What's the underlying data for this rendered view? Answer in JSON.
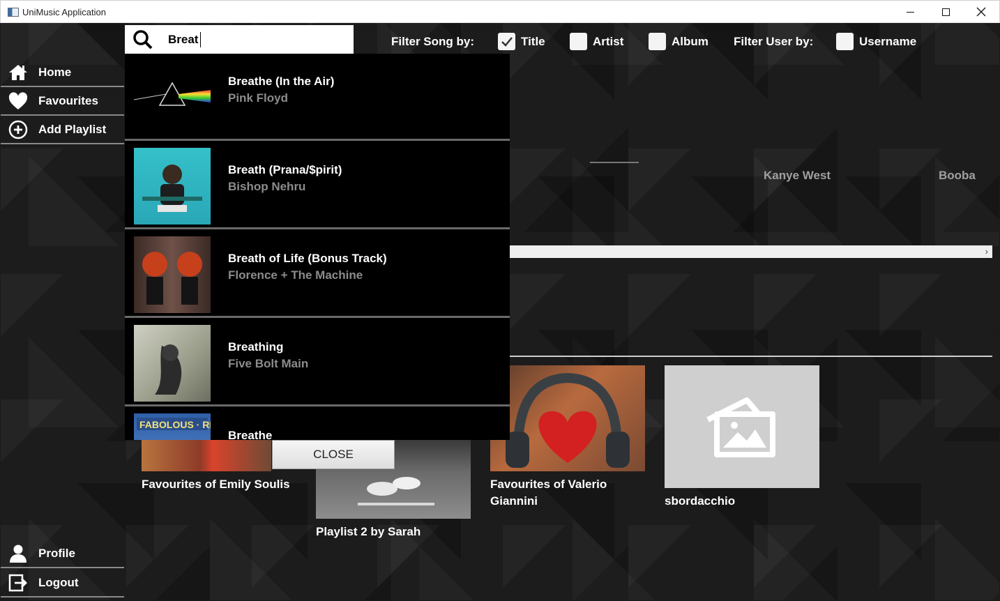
{
  "window": {
    "title": "UniMusic Application"
  },
  "sidebar": {
    "home": "Home",
    "favourites": "Favourites",
    "add_playlist": "Add Playlist",
    "profile": "Profile",
    "logout": "Logout"
  },
  "search": {
    "value": "Breat"
  },
  "filters": {
    "song_label": "Filter Song by:",
    "title": "Title",
    "title_checked": true,
    "artist": "Artist",
    "artist_checked": false,
    "album": "Album",
    "album_checked": false,
    "user_label": "Filter User by:",
    "username": "Username",
    "username_checked": false
  },
  "artists": [
    "Kanye West",
    "Booba"
  ],
  "results": [
    {
      "title": "Breathe (In the Air)",
      "artist": "Pink Floyd"
    },
    {
      "title": "Breath (Prana/$pirit)",
      "artist": "Bishop Nehru"
    },
    {
      "title": "Breath of Life (Bonus Track)",
      "artist": "Florence + The Machine"
    },
    {
      "title": "Breathing",
      "artist": "Five Bolt Main"
    },
    {
      "title": "Breathe",
      "artist": ""
    }
  ],
  "close_label": "CLOSE",
  "playlists": [
    {
      "label": "Favourites of Emily Soulis"
    },
    {
      "label": "Playlist 2 by Sarah"
    },
    {
      "label": "Favourites of Valerio Giannini"
    },
    {
      "label": "sbordacchio"
    }
  ],
  "colors": {
    "accent": "#ffffff",
    "background": "#1c1c1c",
    "dropdown": "#000000"
  }
}
